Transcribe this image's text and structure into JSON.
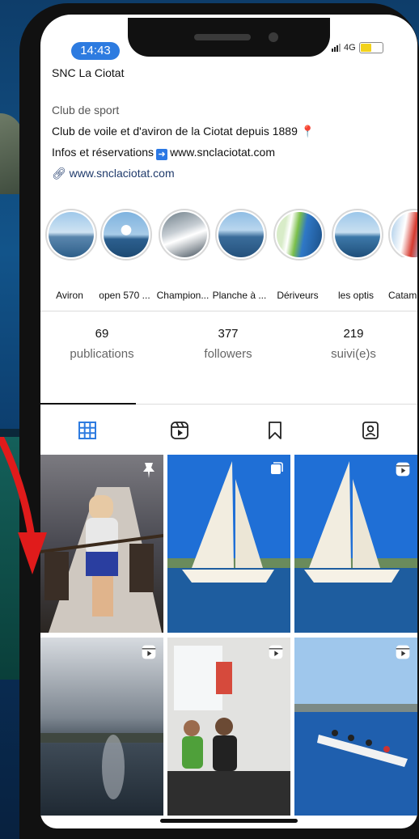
{
  "status_bar": {
    "time": "14:43",
    "network": "4G"
  },
  "profile": {
    "account_name": "SNC La Ciotat",
    "category": "Club de sport",
    "bio_line1": "Club de voile et d'aviron de la Ciotat depuis 1889",
    "bio_line2_prefix": "Infos et réservations",
    "bio_line2_link": "www.snclaciotat.com",
    "website": "www.snclaciotat.com"
  },
  "highlights": [
    {
      "label": "Aviron"
    },
    {
      "label": "open 570 ..."
    },
    {
      "label": "Champion..."
    },
    {
      "label": "Planche à ..."
    },
    {
      "label": "Dériveurs"
    },
    {
      "label": "les optis"
    },
    {
      "label": "Catam"
    }
  ],
  "stats": {
    "posts_count": "69",
    "posts_label": "publications",
    "followers_count": "377",
    "followers_label": "followers",
    "following_count": "219",
    "following_label": "suivi(e)s"
  },
  "tabs": [
    {
      "icon": "grid-icon",
      "selected": true
    },
    {
      "icon": "reels-icon",
      "selected": false
    },
    {
      "icon": "saved-icon",
      "selected": false
    },
    {
      "icon": "tagged-icon",
      "selected": false
    }
  ],
  "posts": [
    {
      "type": "pinned",
      "icon": "pin-icon",
      "subject": "rowing crew at sunset"
    },
    {
      "type": "carousel",
      "icon": "carousel-icon",
      "subject": "classic sailboat"
    },
    {
      "type": "reel",
      "icon": "reel-icon",
      "subject": "classic sailboat"
    },
    {
      "type": "reel",
      "icon": "reel-icon",
      "subject": "harbour at dusk"
    },
    {
      "type": "reel",
      "icon": "reel-icon",
      "subject": "indoor rowing machines"
    },
    {
      "type": "reel",
      "icon": "reel-icon",
      "subject": "rowing boat at sea"
    }
  ],
  "colors": {
    "accent_blue": "#2d7be0",
    "pin_pink": "#e0338a",
    "battery_yellow": "#f2d21b"
  }
}
